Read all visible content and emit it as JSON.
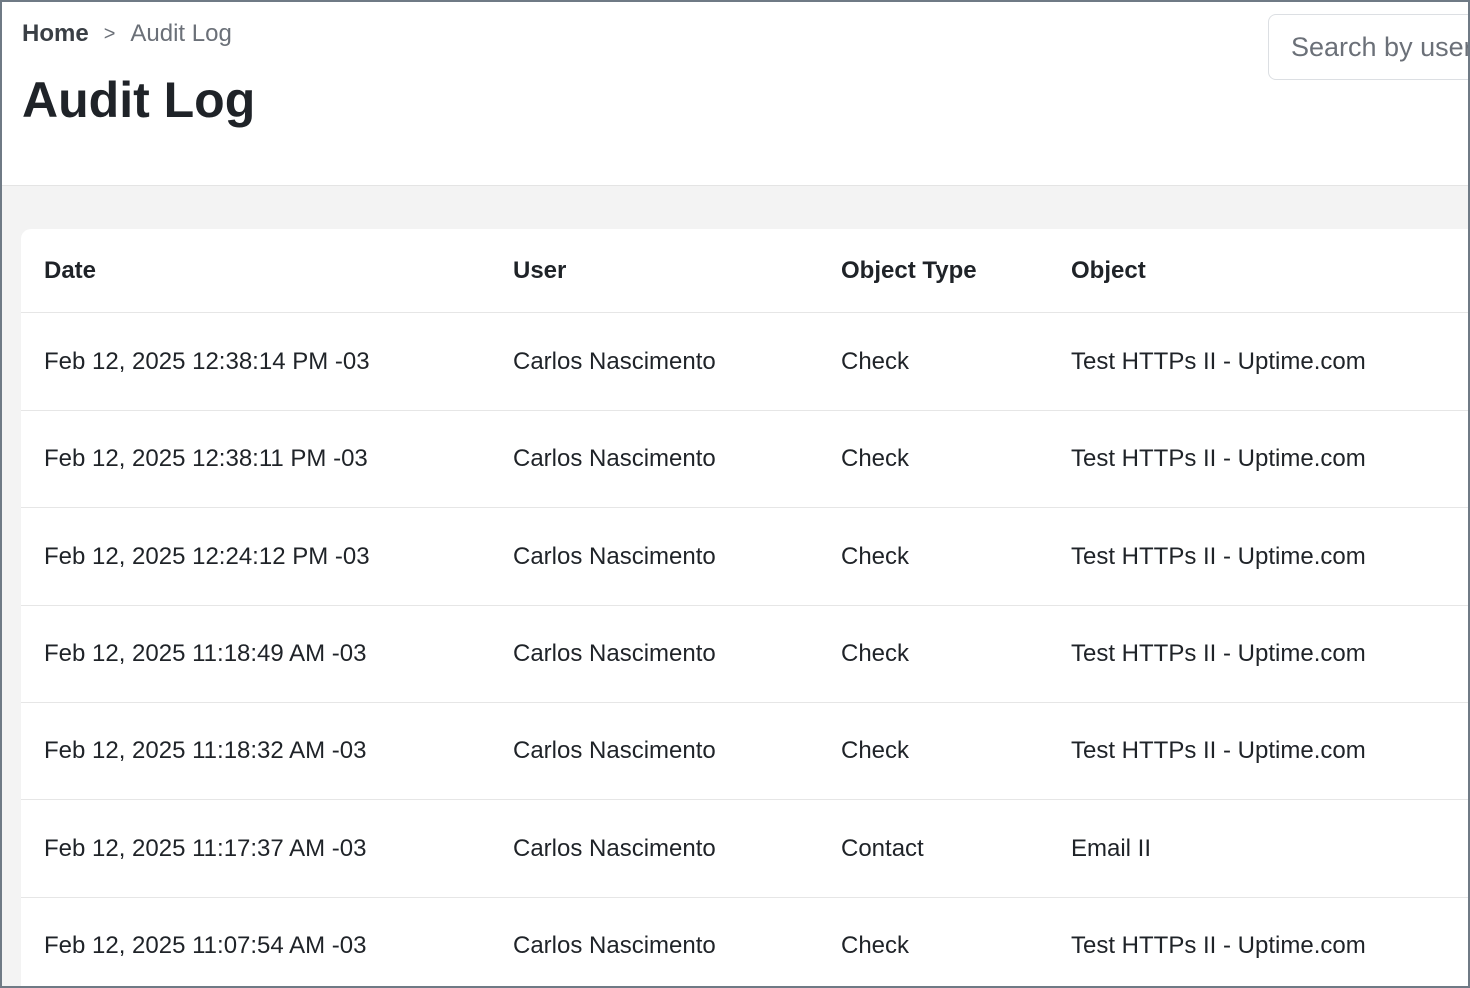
{
  "breadcrumb": {
    "home": "Home",
    "separator": ">",
    "current": "Audit Log"
  },
  "page_title": "Audit Log",
  "search": {
    "placeholder": "Search by user",
    "value": ""
  },
  "table": {
    "columns": [
      "Date",
      "User",
      "Object Type",
      "Object"
    ],
    "rows": [
      {
        "date": "Feb 12, 2025 12:38:14 PM -03",
        "user": "Carlos Nascimento",
        "object_type": "Check",
        "object": "Test HTTPs II - Uptime.com"
      },
      {
        "date": "Feb 12, 2025 12:38:11 PM -03",
        "user": "Carlos Nascimento",
        "object_type": "Check",
        "object": "Test HTTPs II - Uptime.com"
      },
      {
        "date": "Feb 12, 2025 12:24:12 PM -03",
        "user": "Carlos Nascimento",
        "object_type": "Check",
        "object": "Test HTTPs II - Uptime.com"
      },
      {
        "date": "Feb 12, 2025 11:18:49 AM -03",
        "user": "Carlos Nascimento",
        "object_type": "Check",
        "object": "Test HTTPs II - Uptime.com"
      },
      {
        "date": "Feb 12, 2025 11:18:32 AM -03",
        "user": "Carlos Nascimento",
        "object_type": "Check",
        "object": "Test HTTPs II - Uptime.com"
      },
      {
        "date": "Feb 12, 2025 11:17:37 AM -03",
        "user": "Carlos Nascimento",
        "object_type": "Contact",
        "object": "Email II"
      },
      {
        "date": "Feb 12, 2025 11:07:54 AM -03",
        "user": "Carlos Nascimento",
        "object_type": "Check",
        "object": "Test HTTPs II - Uptime.com"
      }
    ]
  }
}
